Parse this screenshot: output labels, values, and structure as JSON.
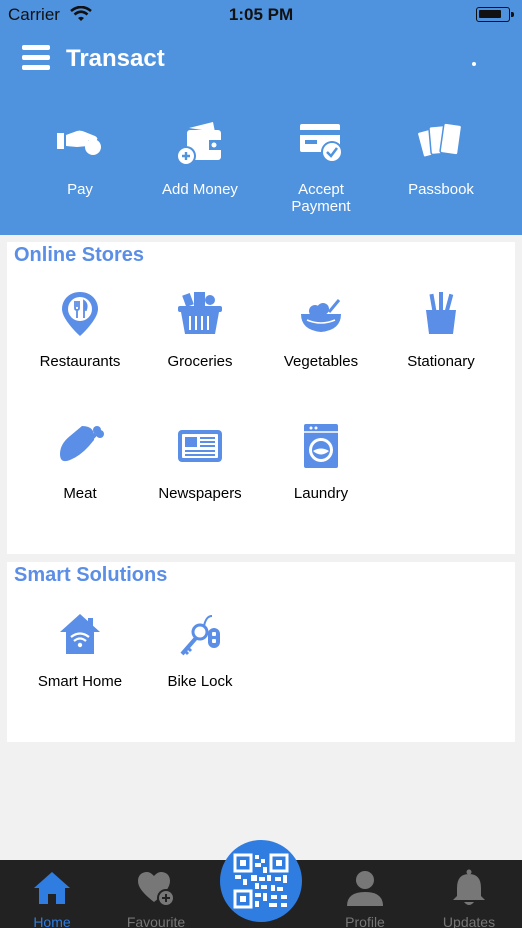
{
  "status_bar": {
    "carrier": "Carrier",
    "time": "1:05 PM"
  },
  "header": {
    "title": "Transact"
  },
  "actions": [
    {
      "label": "Pay",
      "icon": "pay-hand-icon"
    },
    {
      "label": "Add Money",
      "icon": "wallet-add-icon"
    },
    {
      "label": "Accept\nPayment",
      "icon": "card-check-icon"
    },
    {
      "label": "Passbook",
      "icon": "cards-stack-icon"
    }
  ],
  "online_stores": {
    "title": "Online Stores",
    "items": [
      {
        "label": "Restaurants",
        "icon": "restaurant-pin-icon"
      },
      {
        "label": "Groceries",
        "icon": "grocery-basket-icon"
      },
      {
        "label": "Vegetables",
        "icon": "vegetable-bowl-icon"
      },
      {
        "label": "Stationary",
        "icon": "pencil-cup-icon"
      },
      {
        "label": "Meat",
        "icon": "drumstick-icon"
      },
      {
        "label": "Newspapers",
        "icon": "newspaper-icon"
      },
      {
        "label": "Laundry",
        "icon": "washing-machine-icon"
      }
    ]
  },
  "smart_solutions": {
    "title": "Smart Solutions",
    "items": [
      {
        "label": "Smart Home",
        "icon": "smart-home-icon"
      },
      {
        "label": "Bike Lock",
        "icon": "key-lock-icon"
      }
    ]
  },
  "bottom_nav": [
    {
      "label": "Home",
      "icon": "home-icon",
      "active": true
    },
    {
      "label": "Favourite",
      "icon": "heart-add-icon",
      "active": false
    },
    {
      "label": "Profile",
      "icon": "person-icon",
      "active": false
    },
    {
      "label": "Updates",
      "icon": "bell-icon",
      "active": false
    }
  ],
  "colors": {
    "header": "#4f92de",
    "accent": "#5b8ee6",
    "nav_active": "#2f7de1",
    "nav_bg": "#222222"
  }
}
